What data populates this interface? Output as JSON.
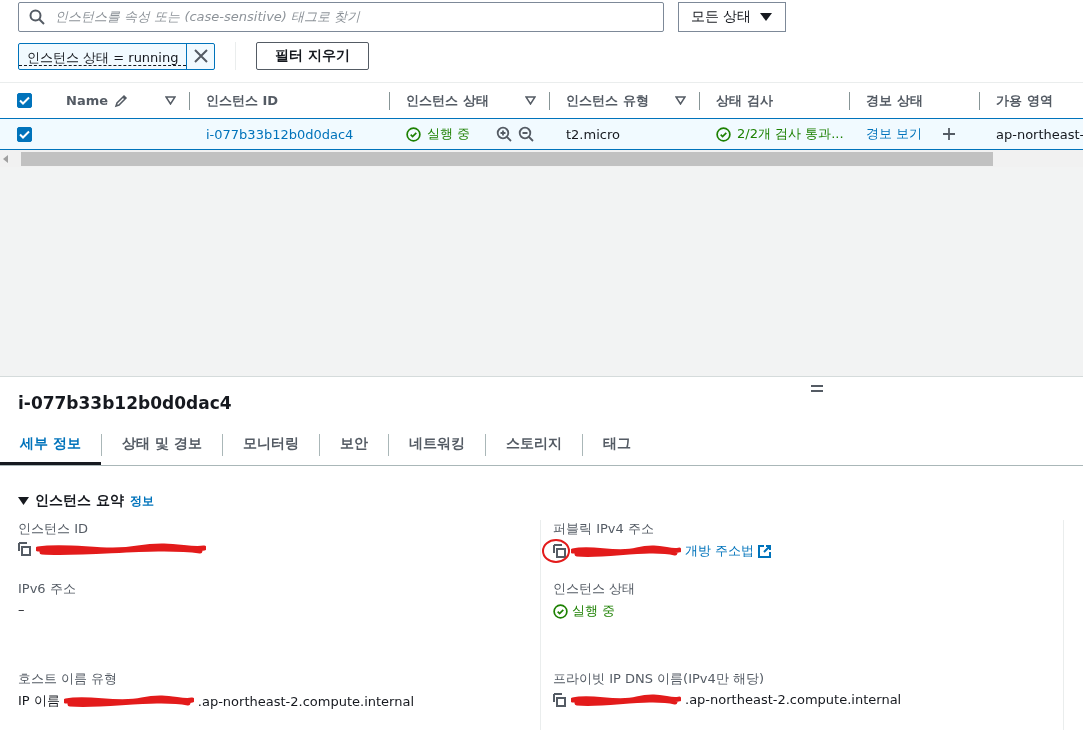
{
  "search": {
    "placeholder": "인스턴스를 속성 또는 (case-sensitive) 태그로 찾기"
  },
  "status_filter": {
    "label": "모든 상태"
  },
  "filter_token": {
    "label": "인스턴스 상태 = running"
  },
  "clear_button": {
    "label": "필터 지우기"
  },
  "table": {
    "all_checked": true,
    "columns": [
      {
        "label": "Name",
        "editable": true,
        "sortable": true
      },
      {
        "label": "인스턴스 ID",
        "editable": false,
        "sortable": false
      },
      {
        "label": "인스턴스 상태",
        "editable": false,
        "sortable": true
      },
      {
        "label": "인스턴스 유형",
        "editable": false,
        "sortable": true
      },
      {
        "label": "상태 검사",
        "editable": false,
        "sortable": false
      },
      {
        "label": "경보 상태",
        "editable": false,
        "sortable": false
      },
      {
        "label": "가용 영역",
        "editable": false,
        "sortable": false
      }
    ],
    "rows": [
      {
        "selected": true,
        "cells": [
          {
            "kind": "text",
            "text": ""
          },
          {
            "kind": "link",
            "text": "i-077b33b12b0d0dac4"
          },
          {
            "kind": "state",
            "text": "실행 중"
          },
          {
            "kind": "text",
            "text": "t2.micro"
          },
          {
            "kind": "check",
            "text": "2/2개 검사 통과..."
          },
          {
            "kind": "alarm",
            "text": "경보 보기"
          },
          {
            "kind": "text",
            "text": "ap-northeast-"
          }
        ]
      }
    ]
  },
  "details": {
    "title": "i-077b33b12b0d0dac4",
    "tabs": [
      {
        "label": "세부 정보",
        "selected": true
      },
      {
        "label": "상태 및 경보",
        "selected": false
      },
      {
        "label": "모니터링",
        "selected": false
      },
      {
        "label": "보안",
        "selected": false
      },
      {
        "label": "네트워킹",
        "selected": false
      },
      {
        "label": "스토리지",
        "selected": false
      },
      {
        "label": "태그",
        "selected": false
      }
    ],
    "section": {
      "title": "인스턴스 요약",
      "info": "정보",
      "expanded": true
    },
    "left": [
      {
        "label": "인스턴스 ID",
        "kind": "redacted-copy"
      },
      {
        "label": "IPv6 주소",
        "kind": "text",
        "value": "–"
      },
      {
        "label": "호스트 이름 유형",
        "kind": "redacted-text",
        "prefix": "IP 이름",
        "suffix": ".ap-northeast-2.compute.internal"
      }
    ],
    "right": [
      {
        "label": "퍼블릭 IPv4 주소",
        "kind": "redacted-link",
        "link": "개방 주소법"
      },
      {
        "label": "인스턴스 상태",
        "kind": "state",
        "value": "실행 중"
      },
      {
        "label": "프라이빗 IP DNS 이름(IPv4만 해당)",
        "kind": "redacted-copy",
        "suffix": ".ap-northeast-2.compute.internal"
      }
    ]
  }
}
